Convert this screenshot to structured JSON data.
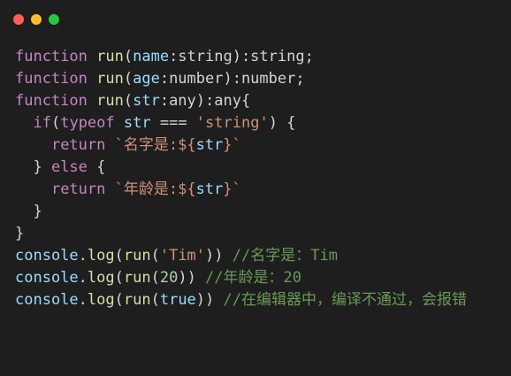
{
  "window": {
    "background": "#1e1e1e",
    "traffic_lights": [
      {
        "name": "close-button",
        "color": "#ff5f57"
      },
      {
        "name": "minimize-button",
        "color": "#febc2e"
      },
      {
        "name": "maximize-button",
        "color": "#28c840"
      }
    ]
  },
  "colors": {
    "keyword": "#c586c0",
    "function": "#dcdcaa",
    "param": "#9cdcfe",
    "plain": "#d4d4d4",
    "string": "#ce9178",
    "number": "#b5cea8",
    "comment": "#6a9955"
  },
  "code_lines": [
    [
      {
        "t": "function",
        "c": "keyword"
      },
      {
        "t": " ",
        "c": "plain"
      },
      {
        "t": "run",
        "c": "function"
      },
      {
        "t": "(",
        "c": "plain"
      },
      {
        "t": "name",
        "c": "param"
      },
      {
        "t": ":string):string;",
        "c": "plain"
      }
    ],
    [
      {
        "t": "function",
        "c": "keyword"
      },
      {
        "t": " ",
        "c": "plain"
      },
      {
        "t": "run",
        "c": "function"
      },
      {
        "t": "(",
        "c": "plain"
      },
      {
        "t": "age",
        "c": "param"
      },
      {
        "t": ":number):number;",
        "c": "plain"
      }
    ],
    [
      {
        "t": "function",
        "c": "keyword"
      },
      {
        "t": " ",
        "c": "plain"
      },
      {
        "t": "run",
        "c": "function"
      },
      {
        "t": "(",
        "c": "plain"
      },
      {
        "t": "str",
        "c": "param"
      },
      {
        "t": ":any):any{",
        "c": "plain"
      }
    ],
    [
      {
        "t": "  ",
        "c": "plain"
      },
      {
        "t": "if",
        "c": "keyword"
      },
      {
        "t": "(",
        "c": "plain"
      },
      {
        "t": "typeof",
        "c": "keyword"
      },
      {
        "t": " ",
        "c": "plain"
      },
      {
        "t": "str",
        "c": "param"
      },
      {
        "t": " === ",
        "c": "plain"
      },
      {
        "t": "'string'",
        "c": "string"
      },
      {
        "t": ") {",
        "c": "plain"
      }
    ],
    [
      {
        "t": "    ",
        "c": "plain"
      },
      {
        "t": "return",
        "c": "keyword"
      },
      {
        "t": " ",
        "c": "plain"
      },
      {
        "t": "`名字是:${",
        "c": "string"
      },
      {
        "t": "str",
        "c": "param"
      },
      {
        "t": "}`",
        "c": "string"
      }
    ],
    [
      {
        "t": "  } ",
        "c": "plain"
      },
      {
        "t": "else",
        "c": "keyword"
      },
      {
        "t": " {",
        "c": "plain"
      }
    ],
    [
      {
        "t": "    ",
        "c": "plain"
      },
      {
        "t": "return",
        "c": "keyword"
      },
      {
        "t": " ",
        "c": "plain"
      },
      {
        "t": "`年龄是:${",
        "c": "string"
      },
      {
        "t": "str",
        "c": "param"
      },
      {
        "t": "}`",
        "c": "string"
      }
    ],
    [
      {
        "t": "  }",
        "c": "plain"
      }
    ],
    [
      {
        "t": "}",
        "c": "plain"
      }
    ],
    [
      {
        "t": "console",
        "c": "param"
      },
      {
        "t": ".",
        "c": "plain"
      },
      {
        "t": "log",
        "c": "function"
      },
      {
        "t": "(",
        "c": "plain"
      },
      {
        "t": "run",
        "c": "function"
      },
      {
        "t": "(",
        "c": "plain"
      },
      {
        "t": "'Tim'",
        "c": "string"
      },
      {
        "t": ")) ",
        "c": "plain"
      },
      {
        "t": "//名字是：Tim",
        "c": "comment"
      }
    ],
    [
      {
        "t": "console",
        "c": "param"
      },
      {
        "t": ".",
        "c": "plain"
      },
      {
        "t": "log",
        "c": "function"
      },
      {
        "t": "(",
        "c": "plain"
      },
      {
        "t": "run",
        "c": "function"
      },
      {
        "t": "(",
        "c": "plain"
      },
      {
        "t": "20",
        "c": "number"
      },
      {
        "t": ")) ",
        "c": "plain"
      },
      {
        "t": "//年龄是：20",
        "c": "comment"
      }
    ],
    [
      {
        "t": "console",
        "c": "param"
      },
      {
        "t": ".",
        "c": "plain"
      },
      {
        "t": "log",
        "c": "function"
      },
      {
        "t": "(",
        "c": "plain"
      },
      {
        "t": "run",
        "c": "function"
      },
      {
        "t": "(",
        "c": "plain"
      },
      {
        "t": "true",
        "c": "param"
      },
      {
        "t": ")) ",
        "c": "plain"
      },
      {
        "t": "//在编辑器中，编译不通过，会报错",
        "c": "comment"
      }
    ]
  ]
}
